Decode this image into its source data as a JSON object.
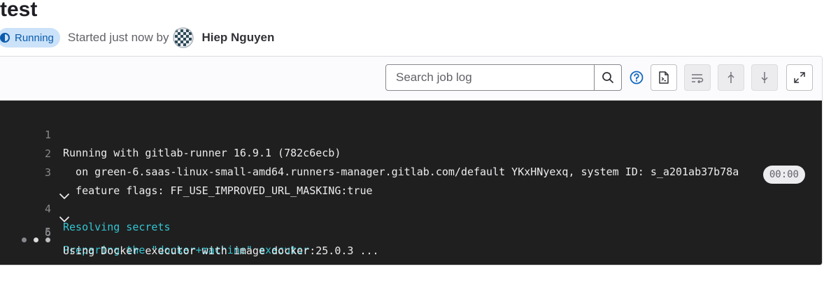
{
  "job": {
    "title": "test",
    "status": "Running",
    "started_text": "Started just now by",
    "author": "Hiep Nguyen"
  },
  "toolbar": {
    "search_placeholder": "Search job log",
    "icons": [
      "search-icon",
      "help-icon",
      "raw-log-icon",
      "line-wrap-icon",
      "scroll-to-top-icon",
      "scroll-to-bottom-icon",
      "fullscreen-icon"
    ]
  },
  "log": {
    "lines": [
      {
        "number": "1",
        "text": "Running with gitlab-runner 16.9.1 (782c6ecb)"
      },
      {
        "number": "2",
        "text": "  on green-6.saas-linux-small-amd64.runners-manager.gitlab.com/default YKxHNyexq, system ID: s_a201ab37b78a"
      },
      {
        "number": "3",
        "text": "  feature flags: FF_USE_IMPROVED_URL_MASKING:true"
      },
      {
        "number": "4",
        "text": "Resolving secrets",
        "duration": "00:00"
      },
      {
        "number": "5",
        "text": "Preparing the \"docker+machine\" executor"
      },
      {
        "number": "6",
        "text": "Using Docker executor with image docker:25.0.3 ..."
      }
    ]
  },
  "colors": {
    "running_badge_bg": "#cbe2f9",
    "running_badge_text": "#0b5cad",
    "terminal_bg": "#1f1f1f",
    "section_header": "#32c5d2"
  }
}
